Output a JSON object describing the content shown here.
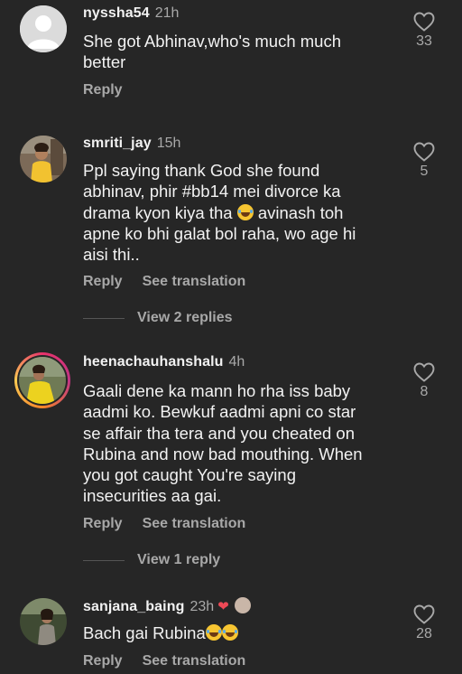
{
  "comments": [
    {
      "username": "nyssha54",
      "time": "21h",
      "text": "She got Abhinav,who's much much better",
      "likes": "33",
      "reply_label": "Reply",
      "translation_label": "",
      "view_replies": "",
      "avatar": "default-avatar"
    },
    {
      "username": "smriti_jay",
      "time": "15h",
      "text_before_emoji": "Ppl saying thank God she found abhinav, phir #bb14 mei divorce ka drama kyon kiya tha ",
      "text_after_emoji": " avinash toh apne ko bhi galat bol raha, wo age hi aisi thi..",
      "likes": "5",
      "reply_label": "Reply",
      "translation_label": "See translation",
      "view_replies": "View 2 replies",
      "avatar": "photo-avatar"
    },
    {
      "username": "heenachauhanshalu",
      "time": "4h",
      "text": "Gaali dene ka mann ho rha iss baby aadmi ko. Bewkuf aadmi apni co star se affair tha tera and you cheated on Rubina and now bad mouthing. When you got caught You're saying insecurities aa gai.",
      "likes": "8",
      "reply_label": "Reply",
      "translation_label": "See translation",
      "view_replies": "View 1 reply",
      "avatar": "story-ring-avatar"
    },
    {
      "username": "sanjana_baing",
      "time": "23h",
      "text": "Bach gai Rubina",
      "likes": "28",
      "reply_label": "Reply",
      "translation_label": "See translation",
      "view_replies": "",
      "avatar": "photo-avatar",
      "creator_liked": true
    }
  ],
  "icons": {
    "like": "heart-outline-icon",
    "creator_like": "heart-filled-icon",
    "emoji": "tears-of-joy-emoji"
  },
  "colors": {
    "background": "#262626",
    "text": "#f2f2f2",
    "muted": "#a8a8a8",
    "liked_heart": "#ed4956"
  }
}
